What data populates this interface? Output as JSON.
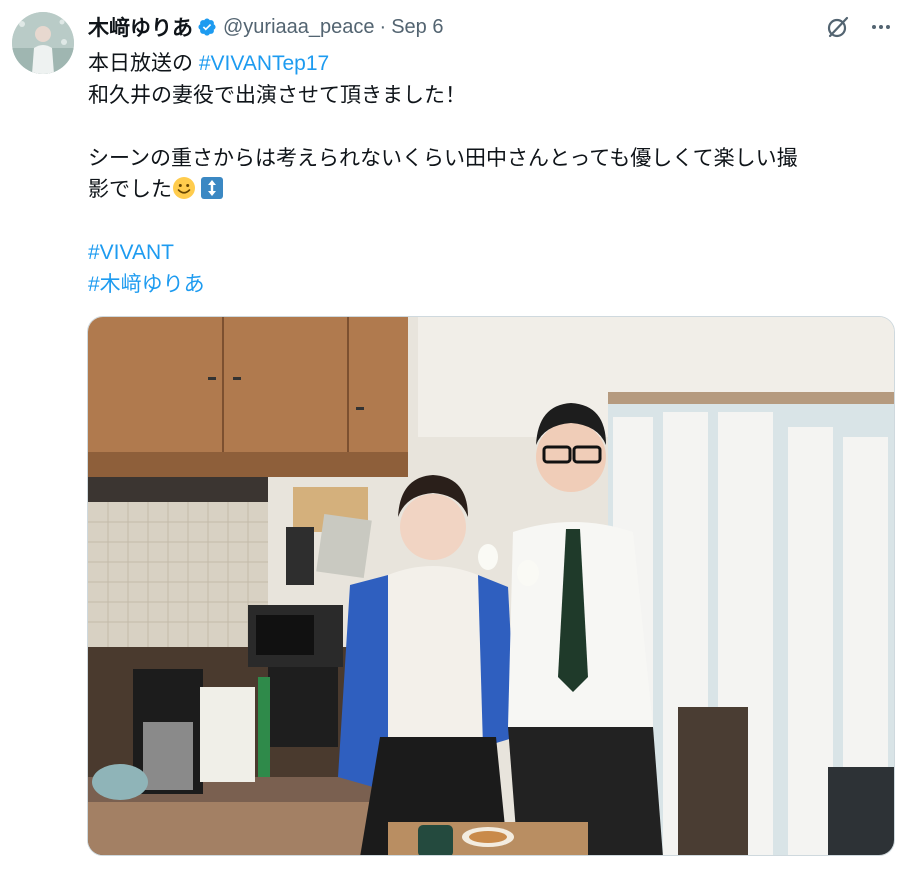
{
  "tweet": {
    "author_name": "木﨑ゆりあ",
    "handle": "@yuriaaa_peace",
    "separator": "·",
    "date": "Sep 6",
    "lines": [
      {
        "prefix": "本日放送の ",
        "hashtag": "#VIVANTep17"
      },
      "和久井の妻役で出演させて頂きました！",
      "シーンの重さからは考えられないくらい田中さんとっても優しくて楽しい撮",
      "影でした"
    ],
    "hashtags": [
      "#VIVANT",
      "#木﨑ゆりあ"
    ],
    "emojis": [
      "slightly-smiling-face-emoji",
      "up-down-arrow-emoji"
    ]
  },
  "icons": {
    "verified": "verified-badge-icon",
    "grok": "grok-icon",
    "more": "more-options-icon"
  },
  "colors": {
    "link": "#1d9bf0",
    "verified": "#1d9bf0",
    "secondary_text": "#536471",
    "primary_text": "#0f1419"
  }
}
